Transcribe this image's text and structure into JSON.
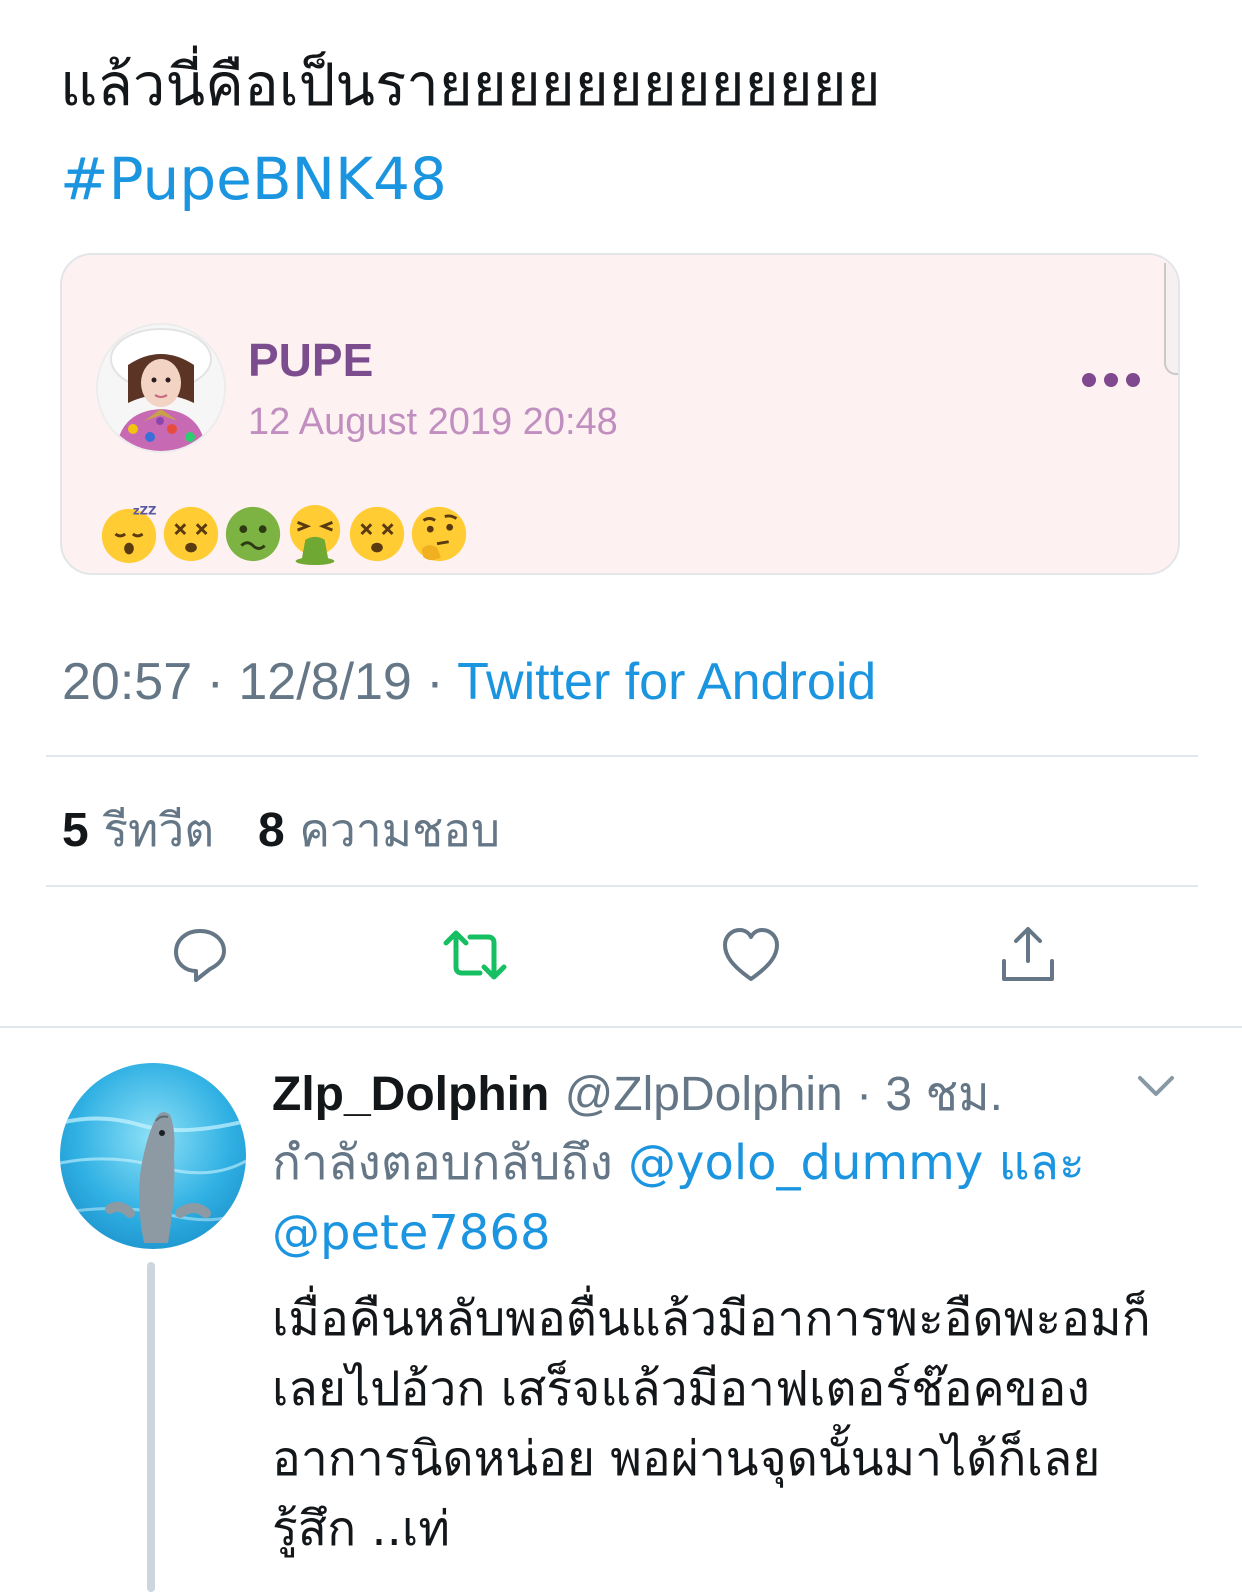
{
  "tweet": {
    "text": "แล้วนี่คือเป็นรายยยยยยยยยยยยย",
    "hashtag": "#PupeBNK48"
  },
  "quote": {
    "name": "PUPE",
    "date": "12 August 2019 20:48",
    "emojis": [
      "sleeping-face",
      "dizzy-face",
      "nauseated-face",
      "vomiting-face",
      "dizzy-face",
      "thinking-face"
    ]
  },
  "meta": {
    "time": "20:57",
    "separator": " · ",
    "date": "12/8/19",
    "source": "Twitter for Android"
  },
  "stats": {
    "retweet_count": "5",
    "retweet_label": "รีทวีต",
    "like_count": "8",
    "like_label": "ความชอบ"
  },
  "actions": {
    "reply": "reply-icon",
    "retweet": "retweet-icon",
    "like": "heart-icon",
    "share": "share-icon"
  },
  "colors": {
    "link": "#1b95e0",
    "retweet": "#17bf63",
    "secondary_text": "#657786",
    "quote_background": "#fdf1f2",
    "quote_name": "#7b4d8e"
  },
  "reply": {
    "name": "Zlp_Dolphin",
    "handle": "@ZlpDolphin",
    "separator": " · ",
    "time": "3 ชม.",
    "replying_to_prefix": "กำลังตอบกลับถึง",
    "mention1": "@yolo_dummy",
    "conjunction": "และ",
    "mention2": "@pete7868",
    "body": "เมื่อคืนหลับพอตื่นแล้วมีอาการพะอืดพะอมก็เลยไปอ้วก เสร็จแล้วมีอาฟเตอร์ช๊อคของอาการนิดหน่อย พอผ่านจุดนั้นมาได้ก็เลยรู้สึก ..เท่"
  }
}
